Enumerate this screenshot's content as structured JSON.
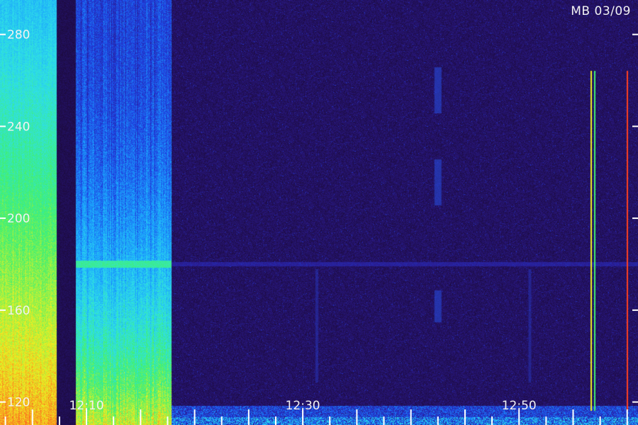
{
  "title": "MB 03/09",
  "chart_data": {
    "type": "heatmap",
    "y_ticks": [
      "280",
      "240",
      "200",
      "160",
      "120"
    ],
    "y_tick_values": [
      280,
      240,
      200,
      160,
      120
    ],
    "ylim": [
      110,
      295
    ],
    "x_ticks": [
      "12:10",
      "12:30",
      "12:50"
    ],
    "x_tick_values": [
      10,
      30,
      50
    ],
    "xlim": [
      2,
      61
    ],
    "x_minor_step": 2.5,
    "colormap": [
      "#1a0833",
      "#2a1a8a",
      "#1f3fe0",
      "#1aa0ff",
      "#2fe0e8",
      "#40f070",
      "#f0f020",
      "#ff4020"
    ],
    "bands": [
      {
        "x_start": 2.0,
        "x_end": 7.2,
        "intensity": "high"
      },
      {
        "x_start": 9.0,
        "x_end": 17.8,
        "intensity": "medium-high"
      }
    ]
  }
}
